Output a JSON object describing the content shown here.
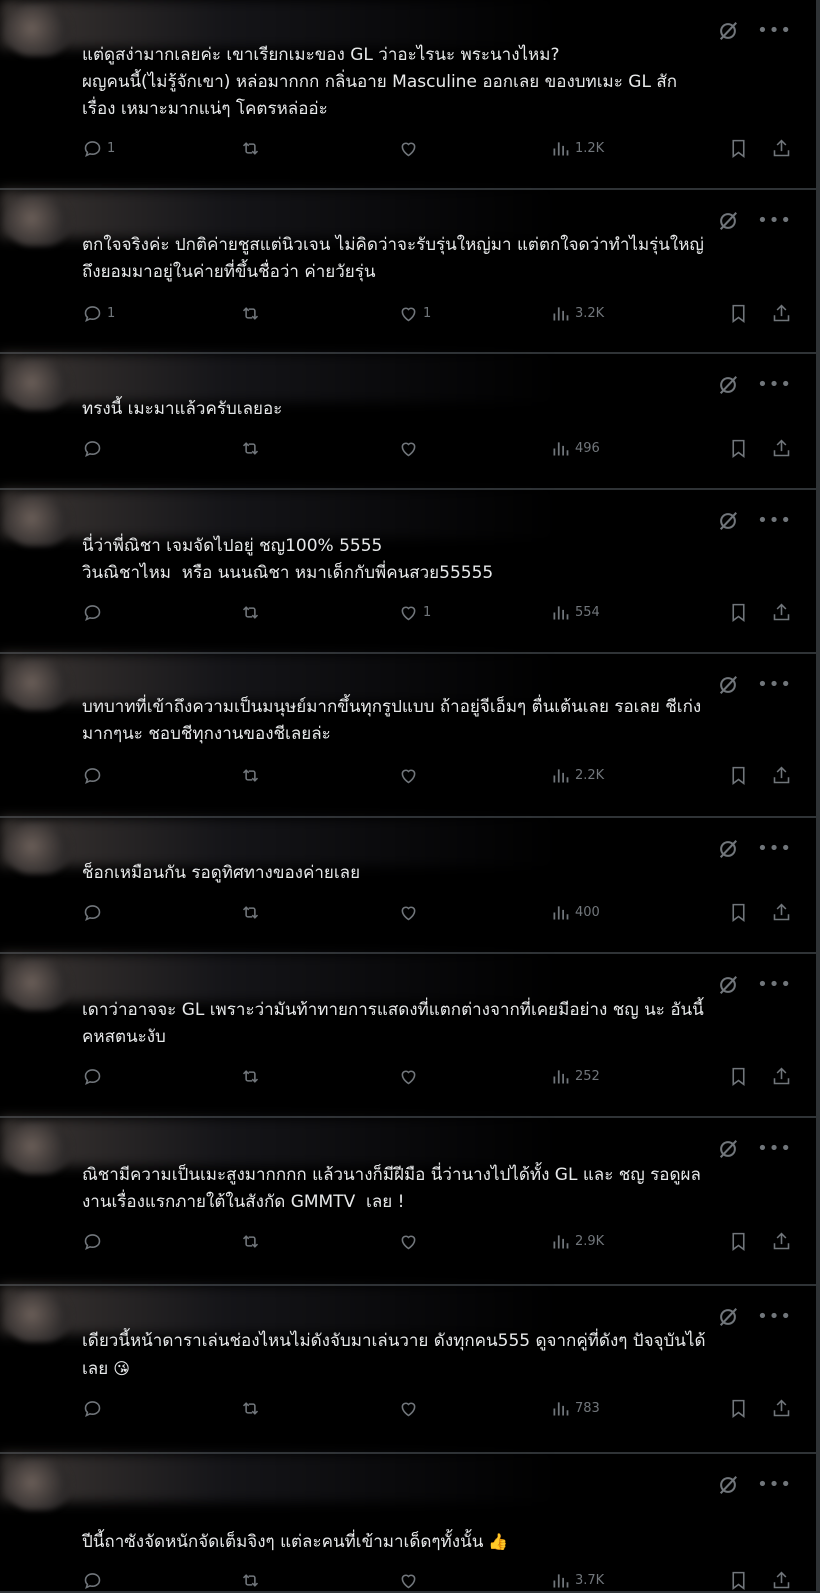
{
  "colors": {
    "background": "#000000",
    "text": "#e7e9ea",
    "muted": "#71767b",
    "divider": "#2f3336"
  },
  "icons": {
    "reply": "reply-icon",
    "repost": "repost-icon",
    "like": "heart-icon",
    "views": "views-icon",
    "bookmark": "bookmark-icon",
    "share": "share-icon",
    "grok": "grok-slash-icon",
    "more": "more-icon"
  },
  "posts": [
    {
      "text": "แต่ดูสง่ามากเลยค่ะ เขาเรียกเมะของ GL ว่าอะไรนะ พระนางไหม?\nผญคนนี้(ไม่รู้จักเขา) หล่อมากกก กลิ่นอาย Masculine ออกเลย ของบทเมะ GL สัก\nเรื่อง เหมาะมากแน่ๆ โคตรหล่ออ่ะ",
      "replies": "1",
      "likes": "",
      "views": "1.2K"
    },
    {
      "text": "ตกใจจริงค่ะ ปกติค่ายชูสแต่นิวเจน ไม่คิดว่าจะรับรุ่นใหญ่มา แต่ตกใจดว่าทำไมรุ่นใหญ่\nถึงยอมมาอยู่ในค่ายที่ขึ้นชื่อว่า ค่ายวัยรุ่น",
      "replies": "1",
      "likes": "1",
      "views": "3.2K"
    },
    {
      "text": "ทรงนี้ เมะมาแล้วครับเลยอะ",
      "replies": "",
      "likes": "",
      "views": "496"
    },
    {
      "text": "นี่ว่าพี่ณิชา เจมจัดไปอยู่ ชญ100% 5555\nวินณิชาไหม  หรือ นนนณิชา หมาเด็กกับพี่คนสวย55555",
      "replies": "",
      "likes": "1",
      "views": "554"
    },
    {
      "text": "บทบาทที่เข้าถึงความเป็นมนุษย์มากขึ้นทุกรูปแบบ ถ้าอยู่จีเอ็มๆ ตื่นเต้นเลย รอเลย ชีเก่ง\nมากๆนะ ชอบชีทุกงานของชีเลยล่ะ",
      "replies": "",
      "likes": "",
      "views": "2.2K"
    },
    {
      "text": "ช็อกเหมือนกัน รอดูทิศทางของค่ายเลย",
      "replies": "",
      "likes": "",
      "views": "400"
    },
    {
      "text": "เดาว่าอาจจะ GL เพราะว่ามันท้าทายการแสดงที่แตกต่างจากที่เคยมีอย่าง ชญ นะ อันนี้\nคหสตนะงับ",
      "replies": "",
      "likes": "",
      "views": "252"
    },
    {
      "text": "ณิชามีความเป็นเมะสูงมากกกก แล้วนางก็มีฝีมือ นี่ว่านางไปได้ทั้ง GL และ ชญ รอดูผล\nงานเรื่องแรกภายใต้ในสังกัด GMMTV  เลย !",
      "replies": "",
      "likes": "",
      "views": "2.9K"
    },
    {
      "text": "เดียวนี้หน้าดาราเล่นช่องไหนไม่ดังจับมาเล่นวาย ดังทุกคน555 ดูจากคู่ที่ดังๆ ปัจจุบันได้\nเลย",
      "emoji": "😘",
      "replies": "",
      "likes": "",
      "views": "783"
    },
    {
      "text": "ปีนี้ถาซังจัดหนักจัดเต็มจิงๆ แต่ละคนที่เข้ามาเด็ดๆทั้งนั้น",
      "emoji": "👍",
      "replies": "",
      "likes": "",
      "views": "3.7K"
    }
  ]
}
